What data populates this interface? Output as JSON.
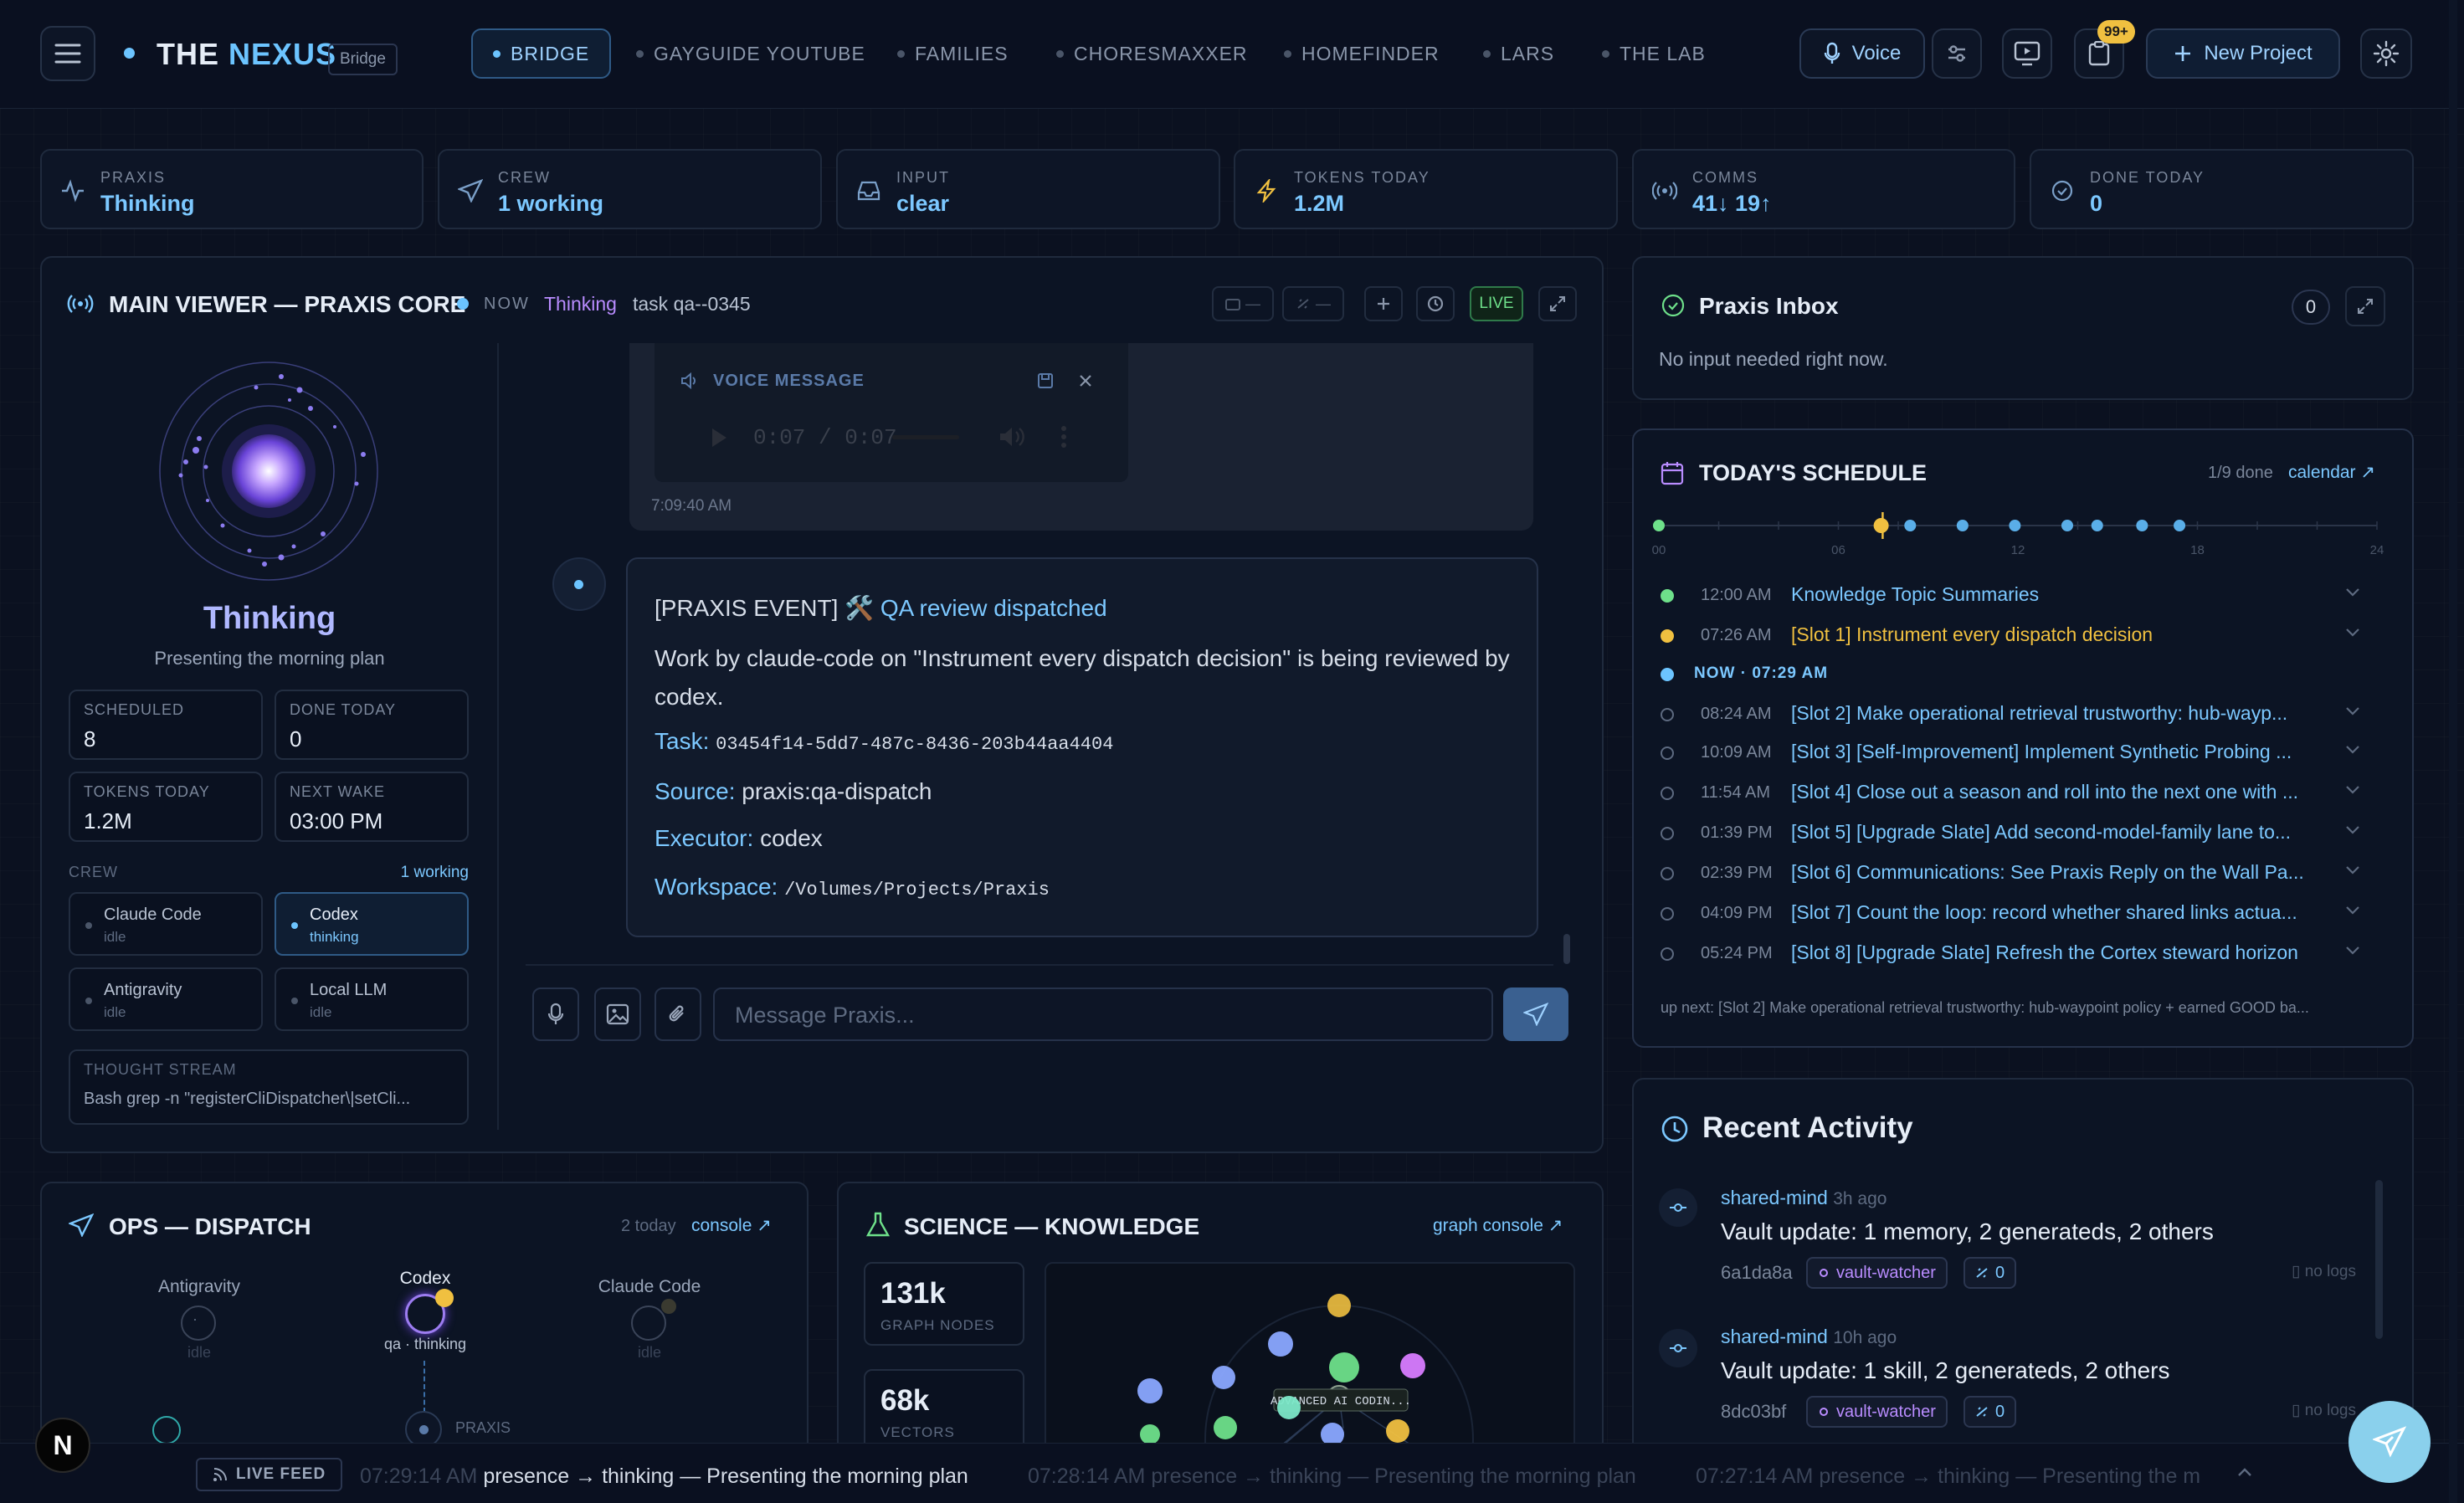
{
  "app": {
    "title_prefix": "THE",
    "title_brand": "NEXUS",
    "badge": "Bridge"
  },
  "nav_tabs": [
    {
      "label": "BRIDGE",
      "active": true
    },
    {
      "label": "GAYGUIDE YOUTUBE"
    },
    {
      "label": "FAMILIES"
    },
    {
      "label": "CHORESMAXXER"
    },
    {
      "label": "HOMEFINDER"
    },
    {
      "label": "LARS"
    },
    {
      "label": "THE LAB"
    }
  ],
  "toolbar": {
    "voice_label": "Voice",
    "notif_badge": "99+",
    "new_project_label": "New Project"
  },
  "stats": [
    {
      "label": "PRAXIS",
      "value": "Thinking",
      "icon": "activity-icon"
    },
    {
      "label": "CREW",
      "value": "1 working",
      "icon": "send-icon"
    },
    {
      "label": "INPUT",
      "value": "clear",
      "icon": "inbox-icon"
    },
    {
      "label": "TOKENS TODAY",
      "value": "1.2M",
      "icon": "bolt-icon"
    },
    {
      "label": "COMMS",
      "value": "41↓ 19↑",
      "icon": "radio-icon"
    },
    {
      "label": "DONE TODAY",
      "value": "0",
      "icon": "check-circle-icon"
    }
  ],
  "main_viewer": {
    "title": "MAIN VIEWER — PRAXIS CORE",
    "now_label": "NOW",
    "now_state": "Thinking",
    "task": "task qa--0345",
    "live_label": "LIVE",
    "ctrl1": "—",
    "ctrl2": "—",
    "core_state": "Thinking",
    "core_sub": "Presenting the morning plan",
    "scheduled": {
      "label": "SCHEDULED",
      "value": "8"
    },
    "done_today": {
      "label": "DONE TODAY",
      "value": "0"
    },
    "tokens_today": {
      "label": "TOKENS TODAY",
      "value": "1.2M"
    },
    "next_wake": {
      "label": "NEXT WAKE",
      "value": "03:00 PM"
    },
    "crew_label": "CREW",
    "crew_working": "1 working",
    "crew": [
      {
        "name": "Claude Code",
        "status": "idle"
      },
      {
        "name": "Codex",
        "status": "thinking",
        "active": true
      },
      {
        "name": "Antigravity",
        "status": "idle"
      },
      {
        "name": "Local LLM",
        "status": "idle"
      }
    ],
    "thought_label": "THOUGHT STREAM",
    "thought_text": "Bash grep -n \"registerCliDispatcher\\|setCli..."
  },
  "chat": {
    "voice_label": "VOICE MESSAGE",
    "audio_time": "0:07 / 0:07",
    "voice_timestamp": "7:09:40 AM",
    "event": {
      "prefix": "[PRAXIS EVENT]",
      "emoji": "🛠️",
      "title": "QA review dispatched",
      "body": "Work by claude-code on \"Instrument every dispatch decision\" is being reviewed by codex.",
      "task_label": "Task:",
      "task_value": "03454f14-5dd7-487c-8436-203b44aa4404",
      "source_label": "Source:",
      "source_value": "praxis:qa-dispatch",
      "executor_label": "Executor:",
      "executor_value": "codex",
      "workspace_label": "Workspace:",
      "workspace_value": "/Volumes/Projects/Praxis"
    },
    "input_placeholder": "Message Praxis..."
  },
  "inbox": {
    "title": "Praxis Inbox",
    "count": "0",
    "empty": "No input needed right now."
  },
  "schedule": {
    "title": "TODAY'S SCHEDULE",
    "progress": "1/9 done",
    "calendar_link": "calendar",
    "axis_ticks": [
      "00",
      "06",
      "12",
      "18",
      "24"
    ],
    "now_label": "NOW · 07:29 AM",
    "marker_hours": [
      0,
      7.43,
      8.4,
      10.15,
      11.9,
      13.65,
      14.65,
      16.15,
      17.4
    ],
    "now_hour": 7.48,
    "items": [
      {
        "time": "12:00 AM",
        "title": "Knowledge Topic Summaries",
        "state": "done"
      },
      {
        "time": "07:26 AM",
        "title": "[Slot 1] Instrument every dispatch decision",
        "state": "active"
      },
      {
        "time": "08:24 AM",
        "title": "[Slot 2] Make operational retrieval trustworthy: hub-wayp...",
        "state": "pending"
      },
      {
        "time": "10:09 AM",
        "title": "[Slot 3] [Self-Improvement] Implement Synthetic Probing ...",
        "state": "pending"
      },
      {
        "time": "11:54 AM",
        "title": "[Slot 4] Close out a season and roll into the next one with ...",
        "state": "pending"
      },
      {
        "time": "01:39 PM",
        "title": "[Slot 5] [Upgrade Slate] Add second-model-family lane to...",
        "state": "pending"
      },
      {
        "time": "02:39 PM",
        "title": "[Slot 6] Communications: See Praxis Reply on the Wall Pa...",
        "state": "pending"
      },
      {
        "time": "04:09 PM",
        "title": "[Slot 7] Count the loop: record whether shared links actua...",
        "state": "pending"
      },
      {
        "time": "05:24 PM",
        "title": "[Slot 8] [Upgrade Slate] Refresh the Cortex steward horizon",
        "state": "pending"
      }
    ],
    "up_next": "up next: [Slot 2] Make operational retrieval trustworthy: hub-waypoint policy + earned GOOD ba..."
  },
  "activity": {
    "title": "Recent Activity",
    "items": [
      {
        "source": "shared-mind",
        "ago": "3h ago",
        "text": "Vault update: 1 memory, 2 generateds, 2 others",
        "hash": "6a1da8a",
        "chip": "vault-watcher",
        "links": "0",
        "logs": "no logs"
      },
      {
        "source": "shared-mind",
        "ago": "10h ago",
        "text": "Vault update: 1 skill, 2 generateds, 2 others",
        "hash": "8dc03bf",
        "chip": "vault-watcher",
        "links": "0",
        "logs": "no logs"
      }
    ]
  },
  "ops": {
    "title": "OPS — DISPATCH",
    "today": "2 today",
    "console_link": "console",
    "agents": [
      {
        "name": "Antigravity",
        "status": "idle"
      },
      {
        "name": "Codex",
        "status": "qa · thinking"
      },
      {
        "name": "Claude Code",
        "status": "idle"
      }
    ],
    "hub_label": "PRAXIS"
  },
  "science": {
    "title": "SCIENCE — KNOWLEDGE",
    "console_link": "graph console",
    "nodes": {
      "value": "131k",
      "label": "GRAPH NODES"
    },
    "vectors": {
      "value": "68k",
      "label": "VECTORS"
    },
    "graph_label": "ADVANCED AI CODIN..."
  },
  "ticker": {
    "label": "LIVE FEED",
    "items": [
      {
        "time": "07:29:14 AM",
        "text": "presence → thinking — Presenting the morning plan"
      },
      {
        "time": "07:28:14 AM",
        "text": "presence → thinking — Presenting the morning plan"
      },
      {
        "time": "07:27:14 AM",
        "text": "presence → thinking — Presenting the m"
      }
    ]
  },
  "colors": {
    "accent": "#7cc8ff",
    "highlight": "#f0c040",
    "purple": "#b98cff",
    "bg": "#0b1120"
  }
}
